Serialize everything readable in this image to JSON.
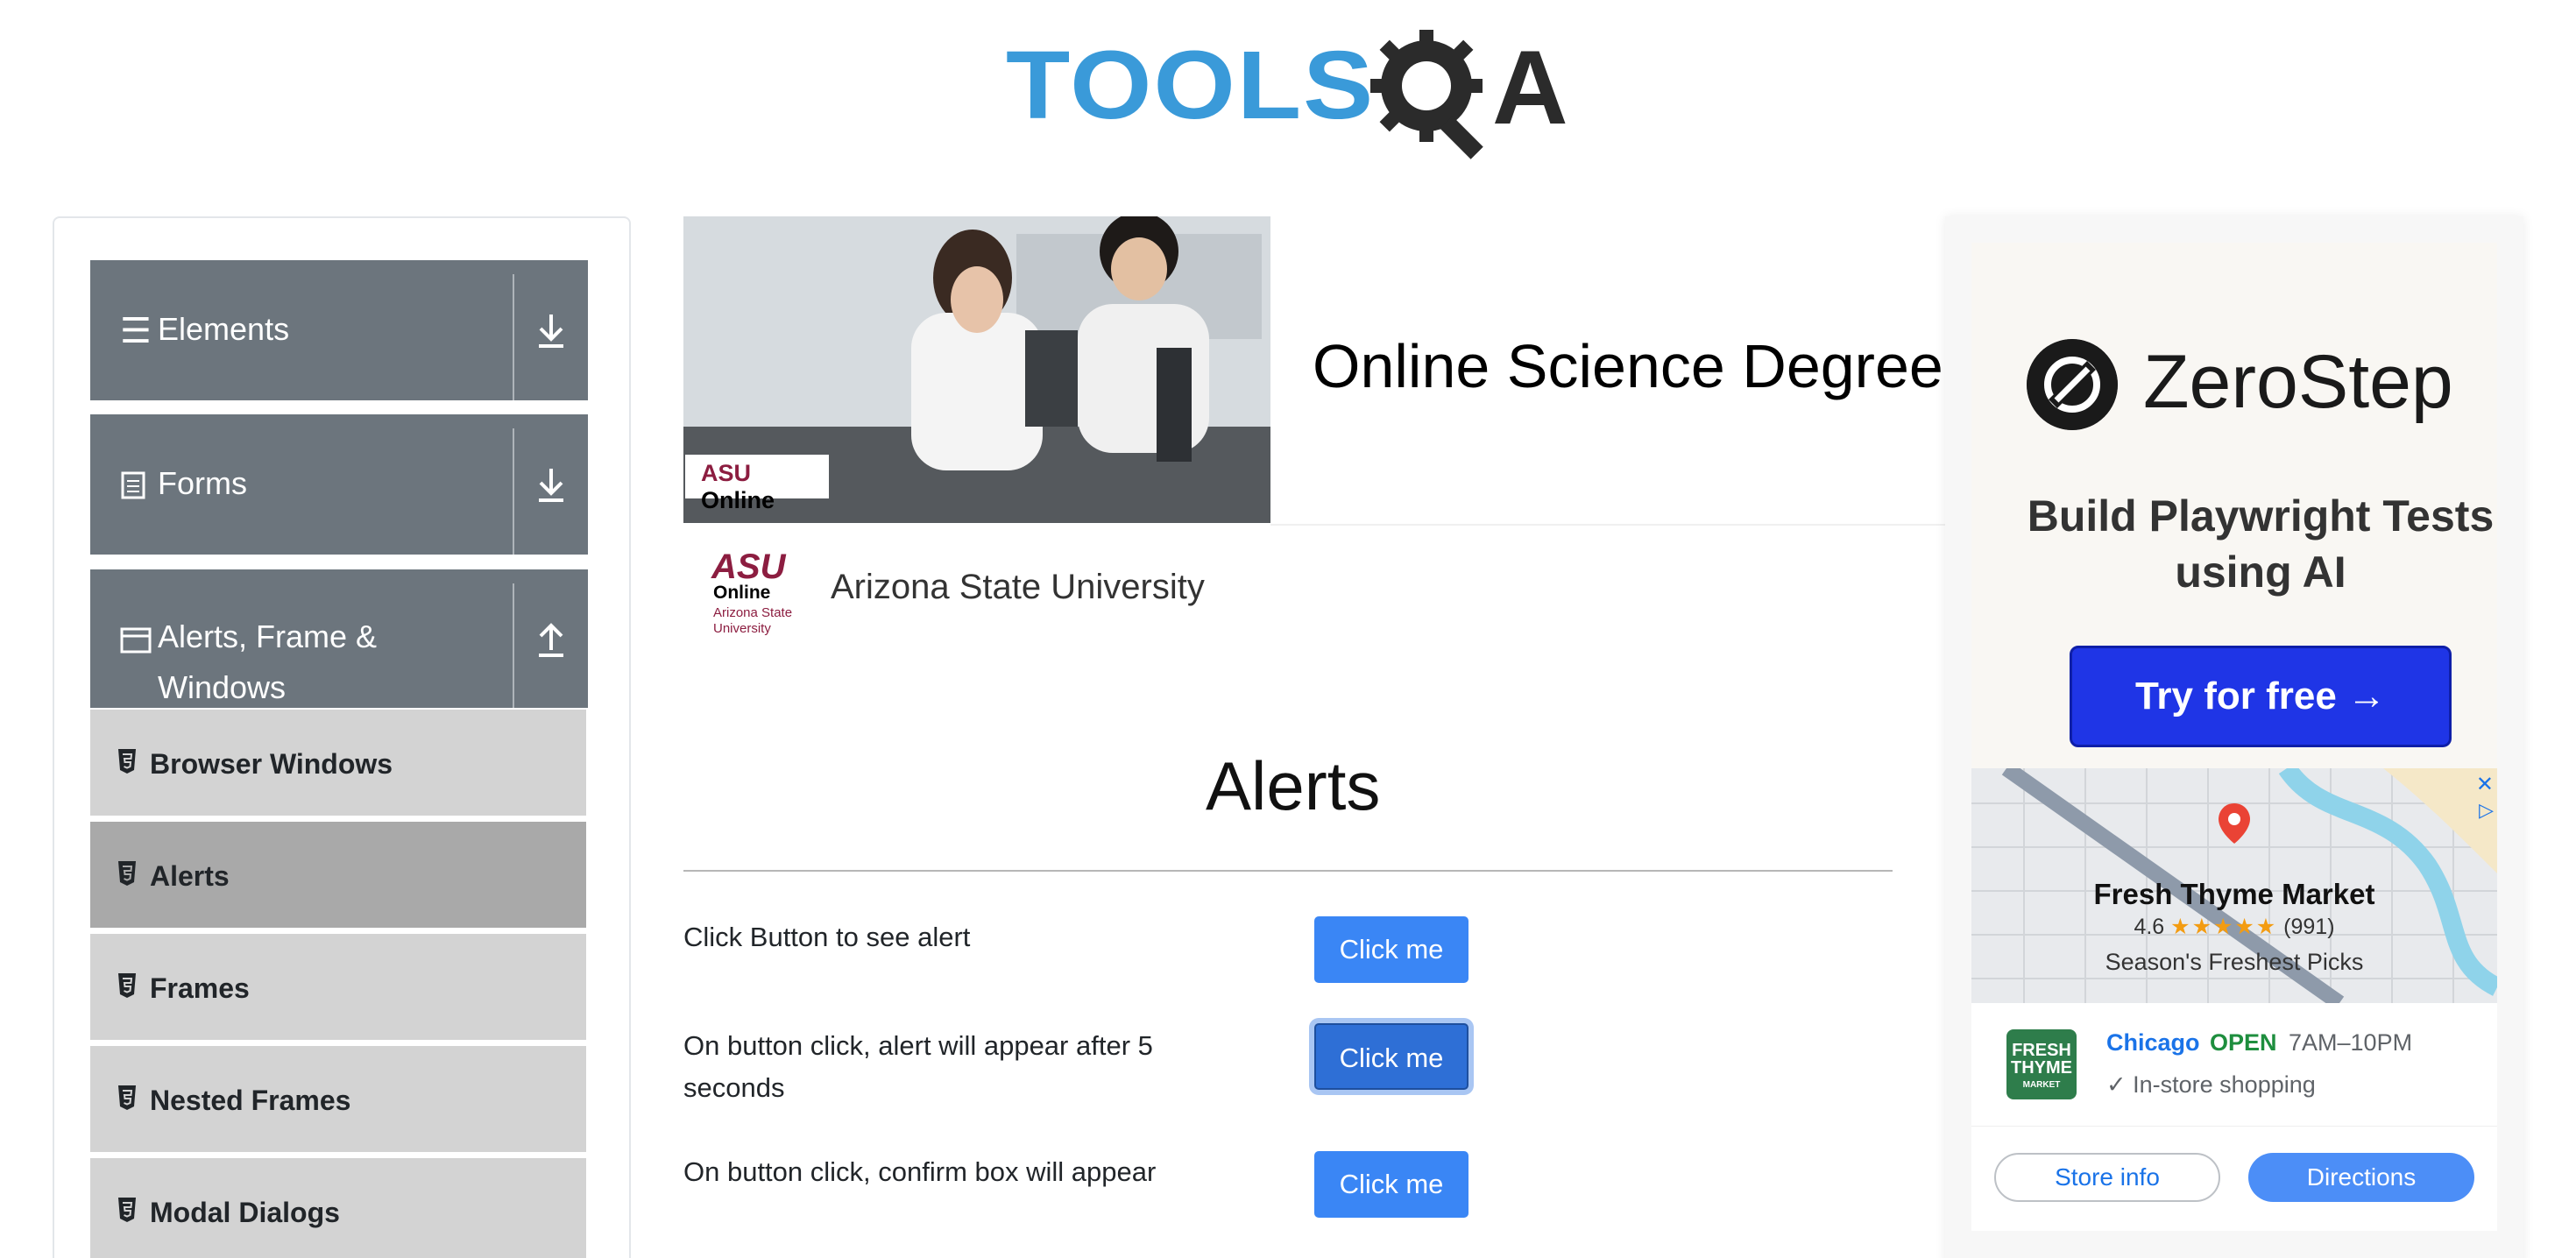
{
  "header": {
    "logo_text": "TOOLS",
    "logo_accent": "A",
    "logo_colors": {
      "primary": "#3a9ad9",
      "dark": "#2b2b2b"
    }
  },
  "sidebar": {
    "groups": [
      {
        "label": "Elements",
        "icon": "list-icon",
        "arrow": "download-icon"
      },
      {
        "label": "Forms",
        "icon": "document-icon",
        "arrow": "download-icon"
      },
      {
        "label": "Alerts, Frame &",
        "label2": "Windows",
        "icon": "window-icon",
        "arrow": "upload-icon"
      }
    ],
    "items": [
      {
        "label": "Browser Windows",
        "active": false
      },
      {
        "label": "Alerts",
        "active": true
      },
      {
        "label": "Frames",
        "active": false
      },
      {
        "label": "Nested Frames",
        "active": false
      },
      {
        "label": "Modal Dialogs",
        "active": false
      }
    ],
    "colors": {
      "group_bg": "#6c757d",
      "item_bg": "#d3d3d3",
      "active_bg": "#a9a9a9"
    }
  },
  "top_ad": {
    "badge": {
      "brand": "ASU",
      "word": "Online",
      "sub": "Arizona State University"
    },
    "headline": "Online Science Degree",
    "advertiser_logo": {
      "line1": "ASU",
      "line2": "Online",
      "line3": "Arizona State University"
    },
    "advertiser_name": "Arizona State University"
  },
  "main": {
    "title": "Alerts",
    "rows": [
      {
        "label": "Click Button to see alert",
        "button": "Click me"
      },
      {
        "label": "On button click, alert will appear after 5 seconds",
        "button": "Click me"
      },
      {
        "label": "On button click, confirm box will appear",
        "button": "Click me"
      }
    ],
    "button_color": "#3a86f5"
  },
  "side_ad": {
    "brand": "ZeroStep",
    "tagline": "Build Playwright Tests using AI",
    "cta": "Try for free →",
    "cta_color": "#1f35e6",
    "map": {
      "store_name": "Fresh Thyme Market",
      "rating": "4.6",
      "stars": "★★★★★",
      "reviews": "(991)",
      "tagline": "Season's Freshest Picks"
    },
    "store": {
      "logo_line1": "FRESH",
      "logo_line2": "THYME",
      "logo_line3": "MARKET",
      "city": "Chicago",
      "status": "OPEN",
      "hours": "7AM–10PM",
      "feature": "✓ In-store shopping"
    },
    "actions": {
      "store_info": "Store info",
      "directions": "Directions"
    }
  }
}
